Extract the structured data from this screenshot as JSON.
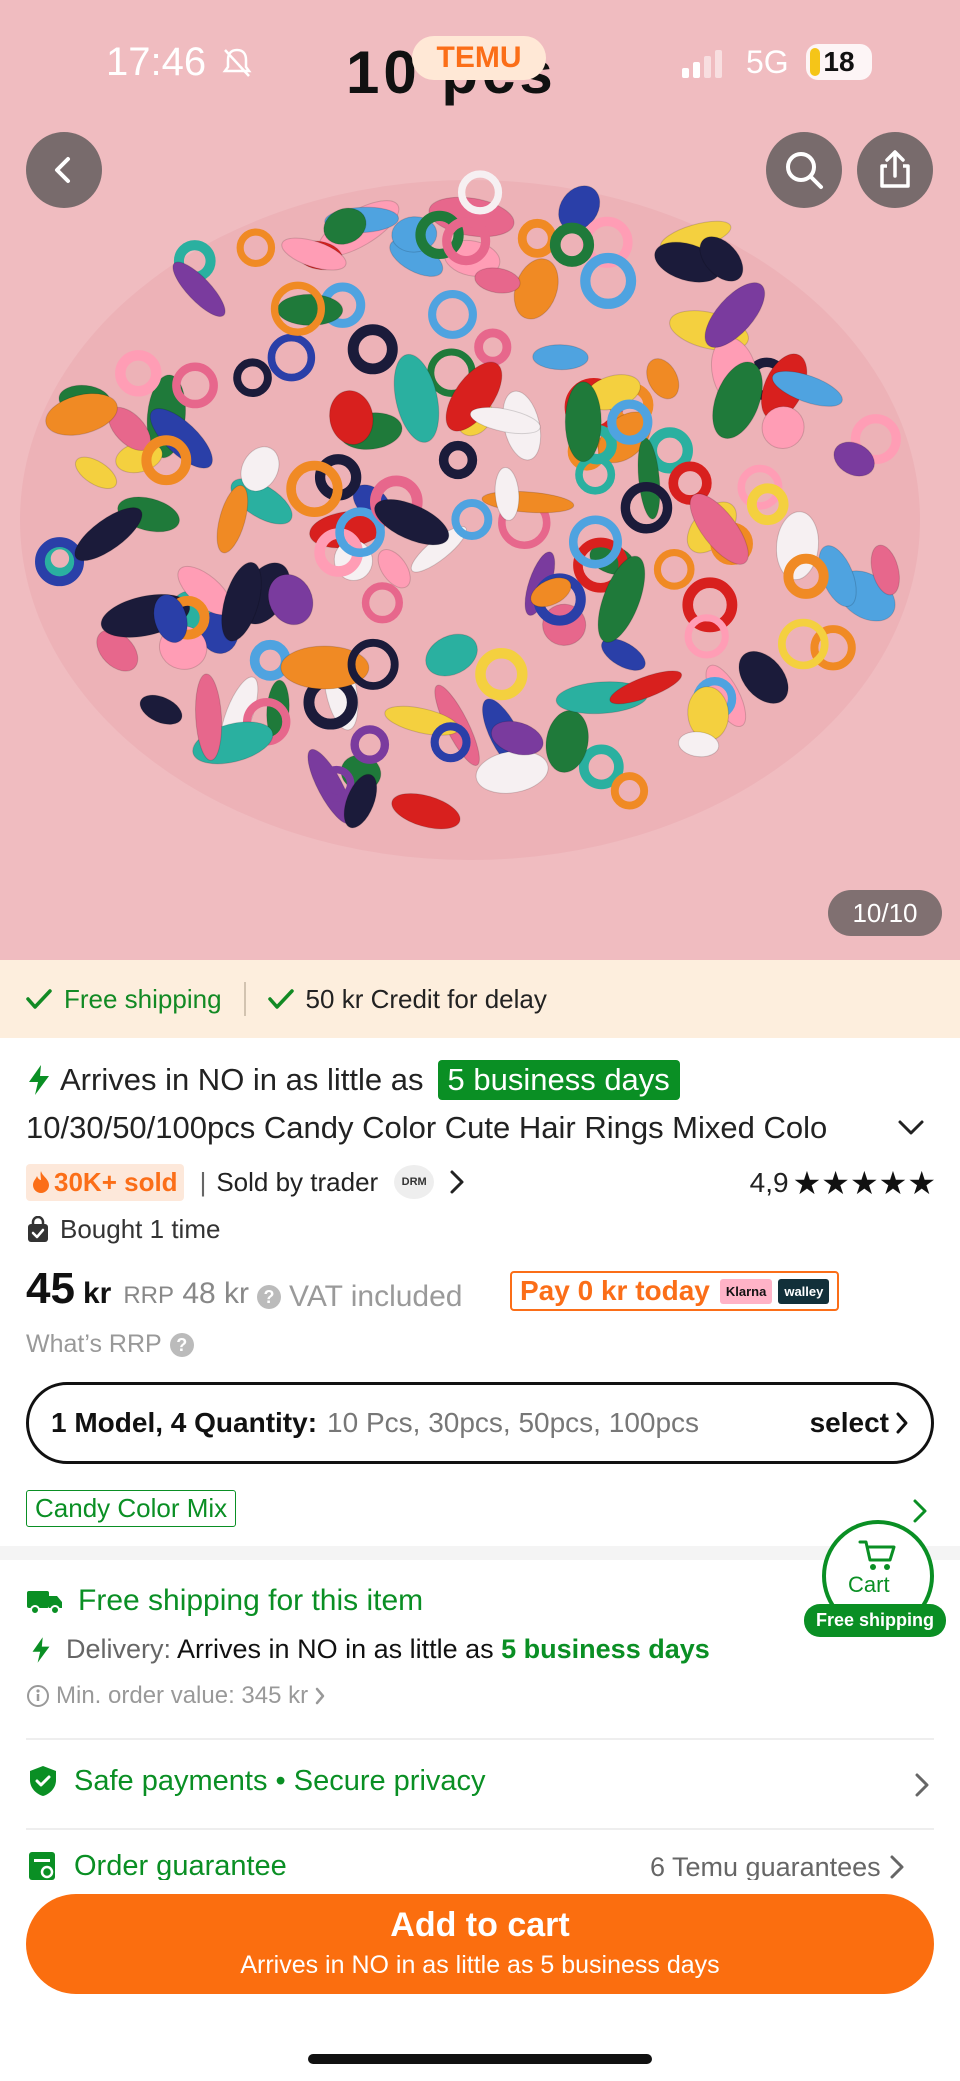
{
  "status_bar": {
    "time": "17:46",
    "network": "5G",
    "battery": "18"
  },
  "hero": {
    "banner_text": "10 pcs",
    "brand": "TEMU",
    "image_counter": "10/10"
  },
  "shipping_bar": {
    "free_shipping": "Free shipping",
    "credit": "50 kr Credit for delay"
  },
  "arrival": {
    "prefix": "Arrives in NO in as little as",
    "highlight": "5 business days"
  },
  "product": {
    "title": "10/30/50/100pcs Candy Color Cute Hair Rings Mixed Colo",
    "sold_badge": "30K+ sold",
    "seller": "Sold by trader",
    "seller_logo": "DRM",
    "rating": "4,9",
    "stars": "★★★★★",
    "bought": "Bought 1 time"
  },
  "price": {
    "value": "45",
    "currency": "kr",
    "rrp_label": "RRP",
    "rrp_value": "48 kr",
    "vat": "VAT included",
    "pay_today": "Pay 0 kr today",
    "klarna": "Klarna",
    "walley": "walley",
    "what_rrp": "What’s RRP"
  },
  "selector": {
    "label": "1 Model, 4 Quantity:",
    "options": "10 Pcs, 30pcs, 50pcs, 100pcs",
    "action": "select"
  },
  "variant": "Candy Color Mix",
  "floating_cart": {
    "label": "Cart",
    "badge": "Free shipping"
  },
  "shipping_info": {
    "title": "Free shipping for this item",
    "delivery_label": "Delivery:",
    "delivery_text": "Arrives in NO in as little as",
    "delivery_days": "5 business days",
    "min_order": "Min. order value: 345 kr"
  },
  "safety": {
    "payments": "Safe payments",
    "privacy": "Secure privacy"
  },
  "guarantee": {
    "label": "Order guarantee",
    "right": "6 Temu guarantees"
  },
  "cta": {
    "label": "Add to cart",
    "sub": "Arrives in NO in as little as 5 business days"
  },
  "colors": {
    "accent": "#fb6e0f",
    "green": "#0a8f24",
    "hero_bg": "#f0bcc0"
  }
}
